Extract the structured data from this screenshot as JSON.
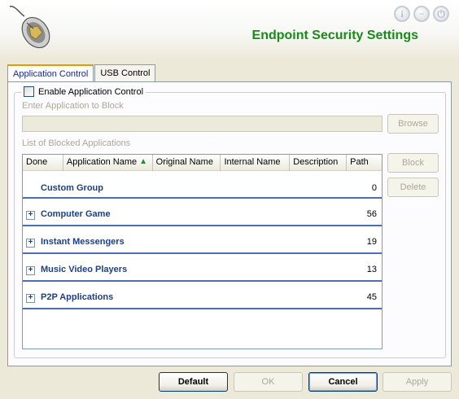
{
  "header": {
    "title": "Endpoint Security Settings",
    "icons": [
      "info-icon",
      "minimize-icon",
      "power-icon"
    ],
    "info_glyph": "i",
    "min_glyph": "−",
    "power_glyph": "⏻"
  },
  "tabs": [
    {
      "label": "Application Control",
      "active": true
    },
    {
      "label": "USB Control",
      "active": false
    }
  ],
  "form": {
    "enable_label": "Enable Application Control",
    "enable_checked": false,
    "enter_label": "Enter Application to Block",
    "app_input_value": "",
    "browse_label": "Browse",
    "list_label": "List of Blocked Applications",
    "block_label": "Block",
    "delete_label": "Delete"
  },
  "table": {
    "columns": [
      "Done",
      "Application Name",
      "Original Name",
      "Internal Name",
      "Description",
      "Path"
    ],
    "groups": [
      {
        "name": "Custom Group",
        "count": "0",
        "expandable": false
      },
      {
        "name": "Computer Game",
        "count": "56",
        "expandable": true
      },
      {
        "name": "Instant Messengers",
        "count": "19",
        "expandable": true
      },
      {
        "name": "Music Video Players",
        "count": "13",
        "expandable": true
      },
      {
        "name": "P2P Applications",
        "count": "45",
        "expandable": true
      }
    ]
  },
  "footer": {
    "default_label": "Default",
    "ok_label": "OK",
    "cancel_label": "Cancel",
    "apply_label": "Apply"
  },
  "colors": {
    "title_green": "#1a8a1a",
    "group_blue": "#1d3f86",
    "separator_blue": "#4a6fb5"
  }
}
